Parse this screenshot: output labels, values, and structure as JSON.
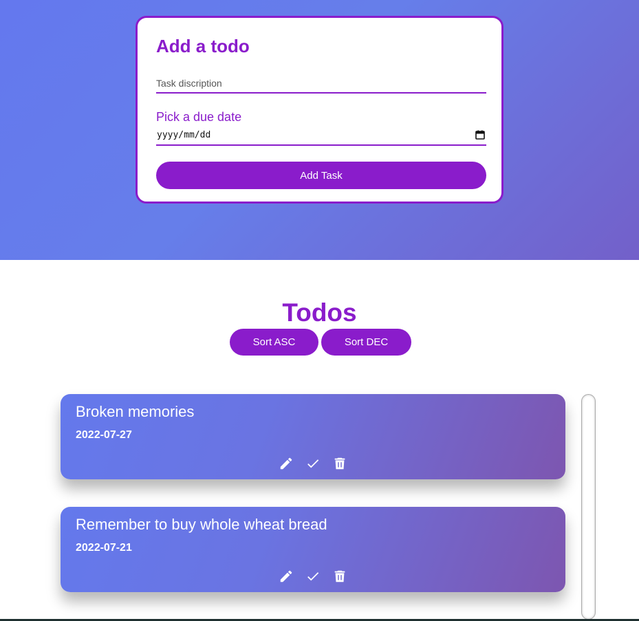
{
  "form": {
    "title": "Add a todo",
    "task_placeholder": "Task discription",
    "task_value": "",
    "due_label": "Pick a due date",
    "date_placeholder": "yyyy/mm/dd",
    "add_button": "Add Task"
  },
  "todos_section": {
    "title": "Todos",
    "sort_asc": "Sort ASC",
    "sort_dec": "Sort DEC"
  },
  "todos": [
    {
      "title": "Broken memories",
      "date": "2022-07-27"
    },
    {
      "title": "Remember to buy whole wheat bread",
      "date": "2022-07-21"
    }
  ],
  "icons": {
    "edit": "pencil-icon",
    "done": "check-icon",
    "delete": "trash-icon",
    "calendar": "calendar-icon"
  },
  "colors": {
    "accent": "#8a1ccb",
    "hero_start": "#6478ee",
    "hero_end": "#7360c9",
    "card_start": "#6479ec",
    "card_end": "#7d56b0"
  }
}
